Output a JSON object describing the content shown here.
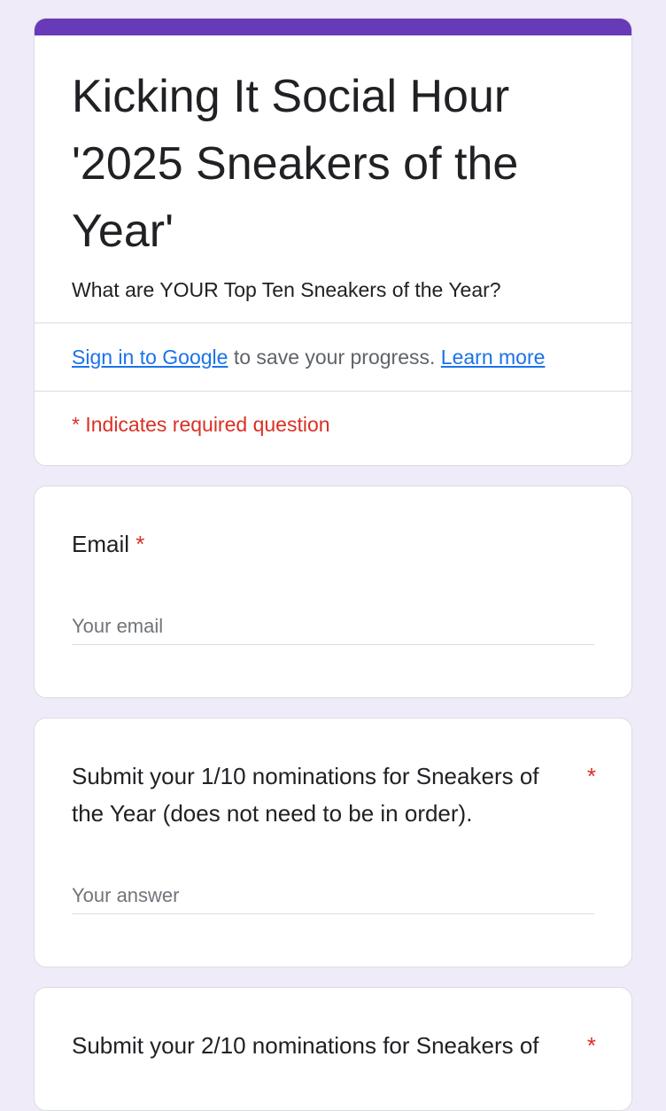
{
  "colors": {
    "background": "#efebf8",
    "accent": "#673ab7",
    "link": "#1a73e8",
    "required": "#d93025",
    "text": "#202124",
    "muted": "#5f6368"
  },
  "header": {
    "title": "Kicking It Social Hour '2025 Sneakers of the Year'",
    "description": "What are YOUR Top Ten Sneakers of the Year?",
    "signin_link": "Sign in to Google",
    "signin_text": " to save your progress. ",
    "learn_more": "Learn more",
    "required_note": "* Indicates required question"
  },
  "questions": [
    {
      "title": "Email",
      "required_mark": "*",
      "placeholder": "Your email"
    },
    {
      "title": "Submit your 1/10 nominations for Sneakers of the Year (does not need to be in order).",
      "required_mark": "*",
      "placeholder": "Your answer"
    },
    {
      "title": "Submit your 2/10 nominations for Sneakers of",
      "required_mark": "*"
    }
  ]
}
